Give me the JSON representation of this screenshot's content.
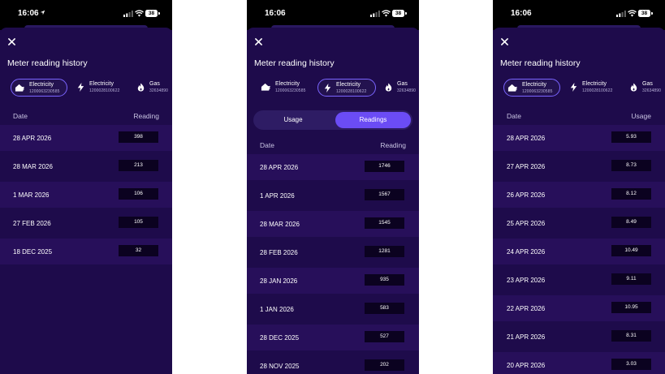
{
  "status": {
    "time": "16:06",
    "battery": "38"
  },
  "title": "Meter reading history",
  "chips": [
    {
      "name": "Electricity",
      "number": "1200063230585"
    },
    {
      "name": "Electricity",
      "number": "1200028100622"
    },
    {
      "name": "Gas",
      "number": "32634890"
    }
  ],
  "screen1": {
    "date_header": "Date",
    "value_header": "Reading",
    "rows": [
      {
        "date": "28 APR 2026",
        "value": "398"
      },
      {
        "date": "28 MAR 2026",
        "value": "213"
      },
      {
        "date": "1 MAR 2026",
        "value": "106"
      },
      {
        "date": "27 FEB 2026",
        "value": "105"
      },
      {
        "date": "18 DEC 2025",
        "value": "32"
      }
    ]
  },
  "screen2": {
    "toggle": {
      "usage": "Usage",
      "readings": "Readings",
      "selected": "Readings"
    },
    "date_header": "Date",
    "value_header": "Reading",
    "rows": [
      {
        "date": "28 APR 2026",
        "value": "1746"
      },
      {
        "date": "1 APR 2026",
        "value": "1567"
      },
      {
        "date": "28 MAR 2026",
        "value": "1545"
      },
      {
        "date": "28 FEB 2026",
        "value": "1281"
      },
      {
        "date": "28 JAN 2026",
        "value": "935"
      },
      {
        "date": "1 JAN 2026",
        "value": "583"
      },
      {
        "date": "28 DEC 2025",
        "value": "527"
      },
      {
        "date": "28 NOV 2025",
        "value": "202"
      }
    ]
  },
  "screen3": {
    "date_header": "Date",
    "value_header": "Usage",
    "rows": [
      {
        "date": "28 APR 2026",
        "value": "5.93"
      },
      {
        "date": "27 APR 2026",
        "value": "8.73"
      },
      {
        "date": "26 APR 2026",
        "value": "8.12"
      },
      {
        "date": "25 APR 2026",
        "value": "8.49"
      },
      {
        "date": "24 APR 2026",
        "value": "10.49"
      },
      {
        "date": "23 APR 2026",
        "value": "9.11"
      },
      {
        "date": "22 APR 2026",
        "value": "10.95"
      },
      {
        "date": "21 APR 2026",
        "value": "8.31"
      },
      {
        "date": "20 APR 2026",
        "value": "3.03"
      }
    ]
  },
  "icons": {
    "close": "close-icon",
    "home": "home-electricity-icon",
    "bolt": "lightning-bolt-icon",
    "gas": "flame-icon"
  },
  "colors": {
    "background": "#1e0b4b",
    "accent": "#6b4cf5",
    "chip_border": "#7a64ff"
  }
}
